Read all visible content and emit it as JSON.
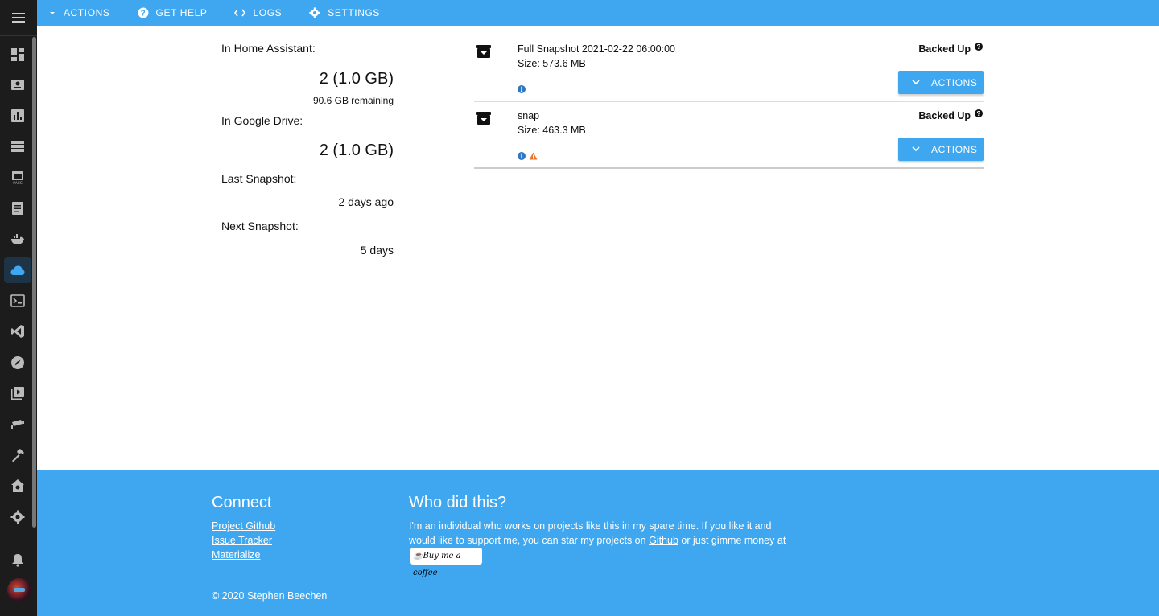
{
  "sidebar": {
    "items": [
      {
        "icon": "dashboard-icon",
        "active": false
      },
      {
        "icon": "map-icon",
        "active": false
      },
      {
        "icon": "history-icon",
        "active": false
      },
      {
        "icon": "media-icon",
        "active": false
      },
      {
        "icon": "hacs-icon",
        "active": false
      },
      {
        "icon": "logbook-icon",
        "active": false
      },
      {
        "icon": "docker-icon",
        "active": false
      },
      {
        "icon": "cloud-icon",
        "active": true
      },
      {
        "icon": "terminal-icon",
        "active": false
      },
      {
        "icon": "vscode-icon",
        "active": false
      },
      {
        "icon": "explore-icon",
        "active": false
      },
      {
        "icon": "media-browser-icon",
        "active": false
      },
      {
        "icon": "camera-icon",
        "active": false
      },
      {
        "icon": "hammer-icon",
        "active": false
      },
      {
        "icon": "supervisor-icon",
        "active": false
      },
      {
        "icon": "gear-icon",
        "active": false
      }
    ]
  },
  "topbar": {
    "actions_label": "ACTIONS",
    "help_label": "GET HELP",
    "logs_label": "LOGS",
    "settings_label": "SETTINGS"
  },
  "stats": {
    "ha_label": "In Home Assistant:",
    "ha_count": "2 (1.0 GB)",
    "ha_remaining": "90.6 GB remaining",
    "drive_label": "In Google Drive:",
    "drive_count": "2 (1.0 GB)",
    "last_label": "Last Snapshot:",
    "last_value": "2 days ago",
    "next_label": "Next Snapshot:",
    "next_value": "5 days"
  },
  "snapshots": [
    {
      "name": "Full Snapshot 2021-02-22 06:00:00",
      "size": "Size: 573.6 MB",
      "status": "Backed Up",
      "warning": false,
      "actions_label": "ACTIONS"
    },
    {
      "name": "snap",
      "size": "Size: 463.3 MB",
      "status": "Backed Up",
      "warning": true,
      "actions_label": "ACTIONS"
    }
  ],
  "footer": {
    "connect_heading": "Connect",
    "links": [
      "Project Github",
      "Issue Tracker",
      "Materialize"
    ],
    "who_heading": "Who did this?",
    "who_text_1": "I'm an individual who works on projects like this in my spare time. If you like it and would like to support me, you can star my projects on ",
    "who_link": "Github",
    "who_text_2": " or just gimme money at ",
    "coffee_label": "Buy me a coffee",
    "copyright": "© 2020 Stephen Beechen"
  },
  "colors": {
    "accent": "#3fa7f0",
    "sidebar_bg": "#1c1c1c",
    "warning": "#e8752a",
    "info": "#2b78c4"
  }
}
